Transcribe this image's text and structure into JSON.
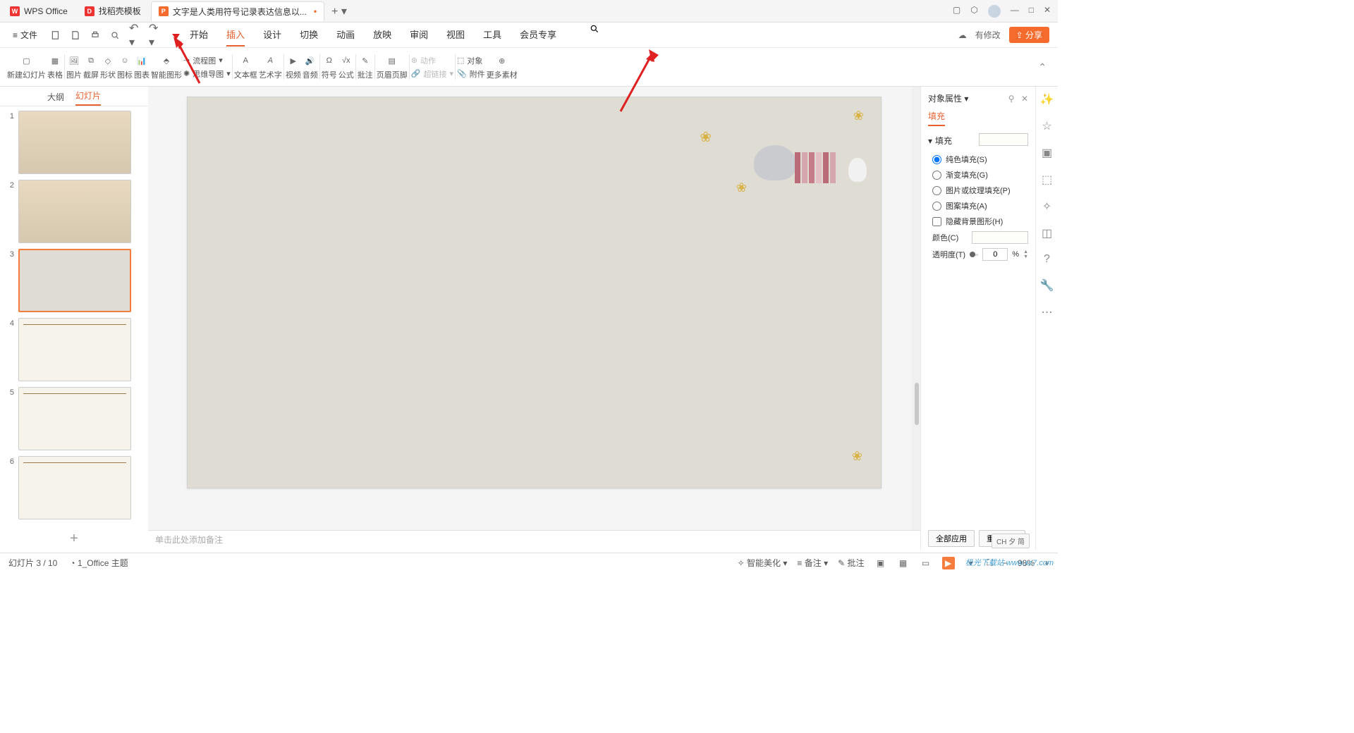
{
  "tabs_top": {
    "wps": "WPS Office",
    "template": "找稻壳模板",
    "doc": "文字是人类用符号记录表达信息以..."
  },
  "file_menu": "文件",
  "menubar_right": {
    "modify": "有修改",
    "share": "分享"
  },
  "tabs": [
    "开始",
    "插入",
    "设计",
    "切换",
    "动画",
    "放映",
    "审阅",
    "视图",
    "工具",
    "会员专享"
  ],
  "active_tab": 1,
  "ribbon": {
    "new_slide": "新建幻灯片",
    "table": "表格",
    "image": "图片",
    "screenshot": "截屏",
    "shape": "形状",
    "icon": "图标",
    "chart": "图表",
    "smartart": "智能图形",
    "flowchart": "流程图",
    "mindmap": "思维导图",
    "textbox": "文本框",
    "wordart": "艺术字",
    "video": "视频",
    "audio": "音频",
    "symbol": "符号",
    "formula": "公式",
    "comment": "批注",
    "header_footer": "页眉页脚",
    "action": "动作",
    "hyperlink": "超链接",
    "object": "对象",
    "attachment": "附件",
    "more": "更多素材"
  },
  "outline": {
    "outline": "大纲",
    "slides": "幻灯片",
    "active": 1
  },
  "slide_numbers": [
    "1",
    "2",
    "3",
    "4",
    "5",
    "6"
  ],
  "selected_slide": 3,
  "notes_placeholder": "单击此处添加备注",
  "props": {
    "title": "对象属性",
    "tab_fill": "填充",
    "section": "填充",
    "solid": "纯色填充(S)",
    "gradient": "渐变填充(G)",
    "picture": "图片或纹理填充(P)",
    "pattern": "图案填充(A)",
    "hide_bg": "隐藏背景图形(H)",
    "color": "颜色(C)",
    "opacity": "透明度(T)",
    "opacity_val": "0",
    "opacity_unit": "%",
    "apply_all": "全部应用",
    "reset_bg": "重置背景"
  },
  "status": {
    "slide_info": "幻灯片 3 / 10",
    "theme": "1_Office 主题",
    "beautify": "智能美化",
    "notes": "备注",
    "comments": "批注",
    "zoom": "98%"
  },
  "ime": "CH 夕 简",
  "watermark": "极光下载站\nwww.xz7.com"
}
